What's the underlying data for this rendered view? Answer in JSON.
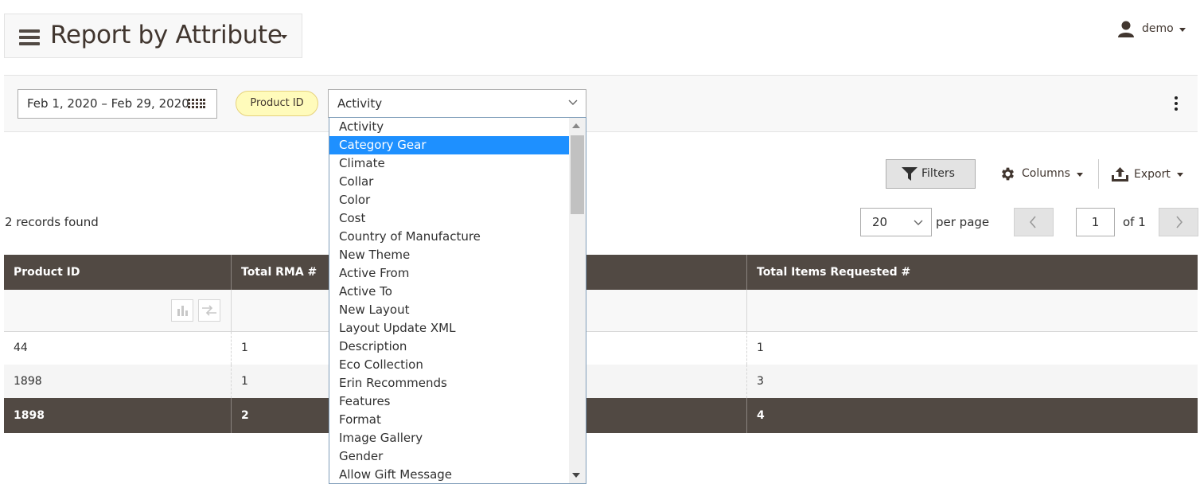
{
  "header": {
    "title": "Report by Attribute",
    "user": "demo"
  },
  "filters": {
    "date_range": "Feb 1, 2020 – Feb 29, 2020",
    "badge": "Product ID",
    "select_value": "Activity",
    "options": [
      "Activity",
      "Category Gear",
      "Climate",
      "Collar",
      "Color",
      "Cost",
      "Country of Manufacture",
      "New Theme",
      "Active From",
      "Active To",
      "New Layout",
      "Layout Update XML",
      "Description",
      "Eco Collection",
      "Erin Recommends",
      "Features",
      "Format",
      "Image Gallery",
      "Gender",
      "Allow Gift Message"
    ],
    "selected_option": "Category Gear"
  },
  "toolbar": {
    "filters_label": "Filters",
    "columns_label": "Columns",
    "export_label": "Export"
  },
  "records": {
    "count_text": "2 records found"
  },
  "pager": {
    "per_page_value": "20",
    "per_page_label": "per page",
    "page": "1",
    "of_label": "of 1"
  },
  "grid": {
    "columns": [
      "Product ID",
      "Total RMA #",
      "",
      "Total Items Requested #"
    ],
    "rows": [
      [
        "44",
        "1",
        "",
        "1"
      ],
      [
        "1898",
        "1",
        "",
        "3"
      ]
    ],
    "totals": [
      "1898",
      "2",
      "",
      "4"
    ]
  },
  "colors": {
    "accent": "#514943",
    "selection": "#1e90ff",
    "badge_bg": "#fffbbb"
  }
}
